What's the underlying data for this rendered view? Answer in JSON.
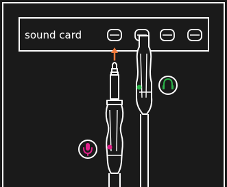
{
  "sound_card": {
    "label": "sound card",
    "port_count": 4
  },
  "cables": [
    {
      "role": "microphone",
      "icon": "microphone-icon",
      "color": "#e0208a"
    },
    {
      "role": "headphones",
      "icon": "headphones-icon",
      "color": "#2bb34a"
    }
  ],
  "insert_arrow_color": "#f07a3c",
  "colors": {
    "background": "#1a1a1a",
    "line": "#ffffff"
  }
}
